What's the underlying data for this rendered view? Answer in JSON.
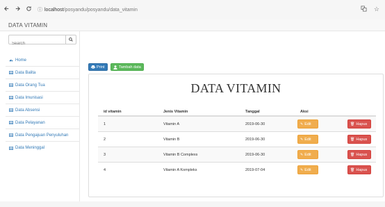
{
  "browser": {
    "back_icon": "arrow-left-icon",
    "forward_icon": "arrow-right-icon",
    "reload_icon": "reload-icon",
    "url_host": "localhost",
    "url_path": "/posyandu/posyandu/data_vitamin"
  },
  "app": {
    "brand": "DATA VITAMIN",
    "search_placeholder": "Search"
  },
  "sidebar": {
    "items": [
      {
        "label": "Home",
        "icon": "dashboard-icon"
      },
      {
        "label": "Data Balita",
        "icon": "table-icon"
      },
      {
        "label": "Data Orang Tua",
        "icon": "table-icon"
      },
      {
        "label": "Data Imunisasi",
        "icon": "table-icon"
      },
      {
        "label": "Data Absensi",
        "icon": "table-icon"
      },
      {
        "label": "Data Pelayanan",
        "icon": "table-icon"
      },
      {
        "label": "Data Pengajuan Penyuluhan",
        "icon": "table-icon"
      },
      {
        "label": "Data Meninggal",
        "icon": "table-icon"
      }
    ]
  },
  "toolbar": {
    "print_label": "Print",
    "add_label": "Tambah data"
  },
  "page": {
    "title": "DATA VITAMIN"
  },
  "table": {
    "headers": {
      "id": "id vitamin",
      "jenis": "Jenis Vitamin",
      "tanggal": "Tanggal",
      "aksi": "Aksi"
    },
    "edit_label": "Edit",
    "delete_label": "Hapus",
    "rows": [
      {
        "id": "1",
        "jenis": "Vitamin A",
        "tanggal": "2019-06-30"
      },
      {
        "id": "2",
        "jenis": "Vitamin B",
        "tanggal": "2019-06-30"
      },
      {
        "id": "3",
        "jenis": "Vitamin B Complexs",
        "tanggal": "2019-06-30"
      },
      {
        "id": "4",
        "jenis": "Vitamin A Kompleks",
        "tanggal": "2019-07-04"
      }
    ]
  },
  "colors": {
    "primary": "#337ab7",
    "success": "#5cb85c",
    "warning": "#f0ad4e",
    "danger": "#d9534f"
  }
}
